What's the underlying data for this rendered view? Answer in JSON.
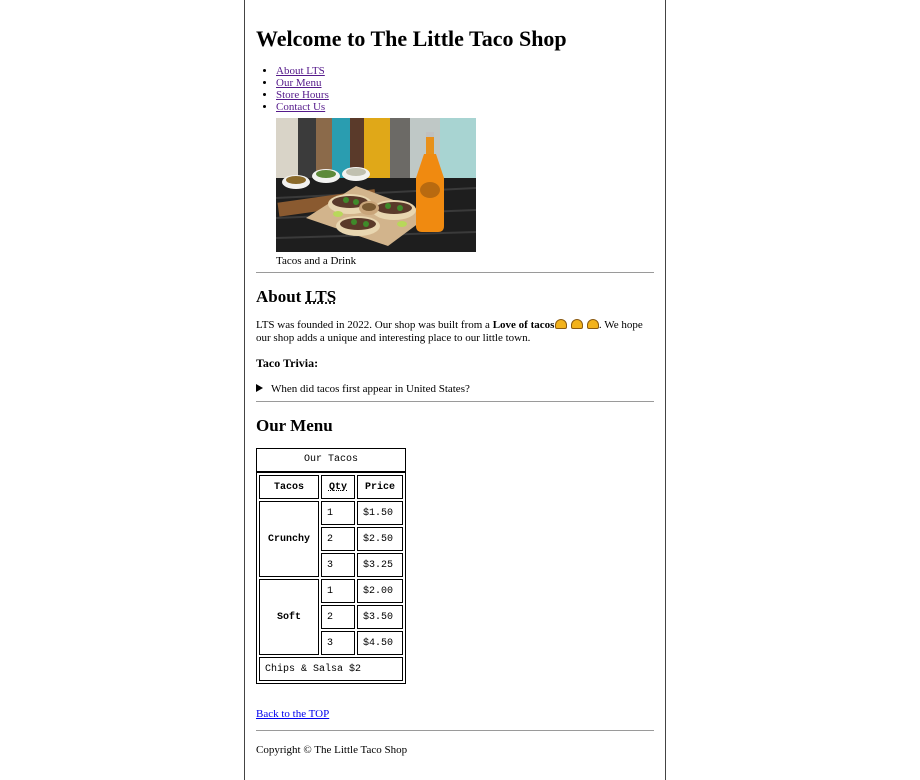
{
  "header": {
    "title": "Welcome to The Little Taco Shop"
  },
  "nav": {
    "items": [
      {
        "label": "About LTS"
      },
      {
        "label": "Our Menu"
      },
      {
        "label": "Store Hours"
      },
      {
        "label": "Contact Us"
      }
    ]
  },
  "figure": {
    "caption": "Tacos and a Drink"
  },
  "about": {
    "heading_prefix": "About ",
    "heading_abbr": "LTS",
    "text_before": "LTS was founded in 2022. Our shop was built from a ",
    "text_bold": "Love of tacos",
    "text_after": ". We hope our shop adds a unique and interesting place to our little town.",
    "trivia_heading": "Taco Trivia:",
    "trivia_question": "When did tacos first appear in United States?"
  },
  "menu": {
    "heading": "Our Menu",
    "caption": "Our Tacos",
    "columns": [
      "Tacos",
      "Qty",
      "Price"
    ],
    "groups": [
      {
        "name": "Crunchy",
        "rows": [
          {
            "qty": "1",
            "price": "$1.50"
          },
          {
            "qty": "2",
            "price": "$2.50"
          },
          {
            "qty": "3",
            "price": "$3.25"
          }
        ]
      },
      {
        "name": "Soft",
        "rows": [
          {
            "qty": "1",
            "price": "$2.00"
          },
          {
            "qty": "2",
            "price": "$3.50"
          },
          {
            "qty": "3",
            "price": "$4.50"
          }
        ]
      }
    ],
    "footer": "Chips & Salsa $2"
  },
  "links": {
    "back_to_top": "Back to the TOP"
  },
  "footer": {
    "copyright": "Copyright © The Little Taco Shop"
  },
  "colors": {
    "visited_link": "#551a8b",
    "link": "#0000ee",
    "border": "#444444"
  },
  "icons": {
    "taco_emoji": "taco-icon",
    "details_marker": "triangle-right-icon"
  }
}
